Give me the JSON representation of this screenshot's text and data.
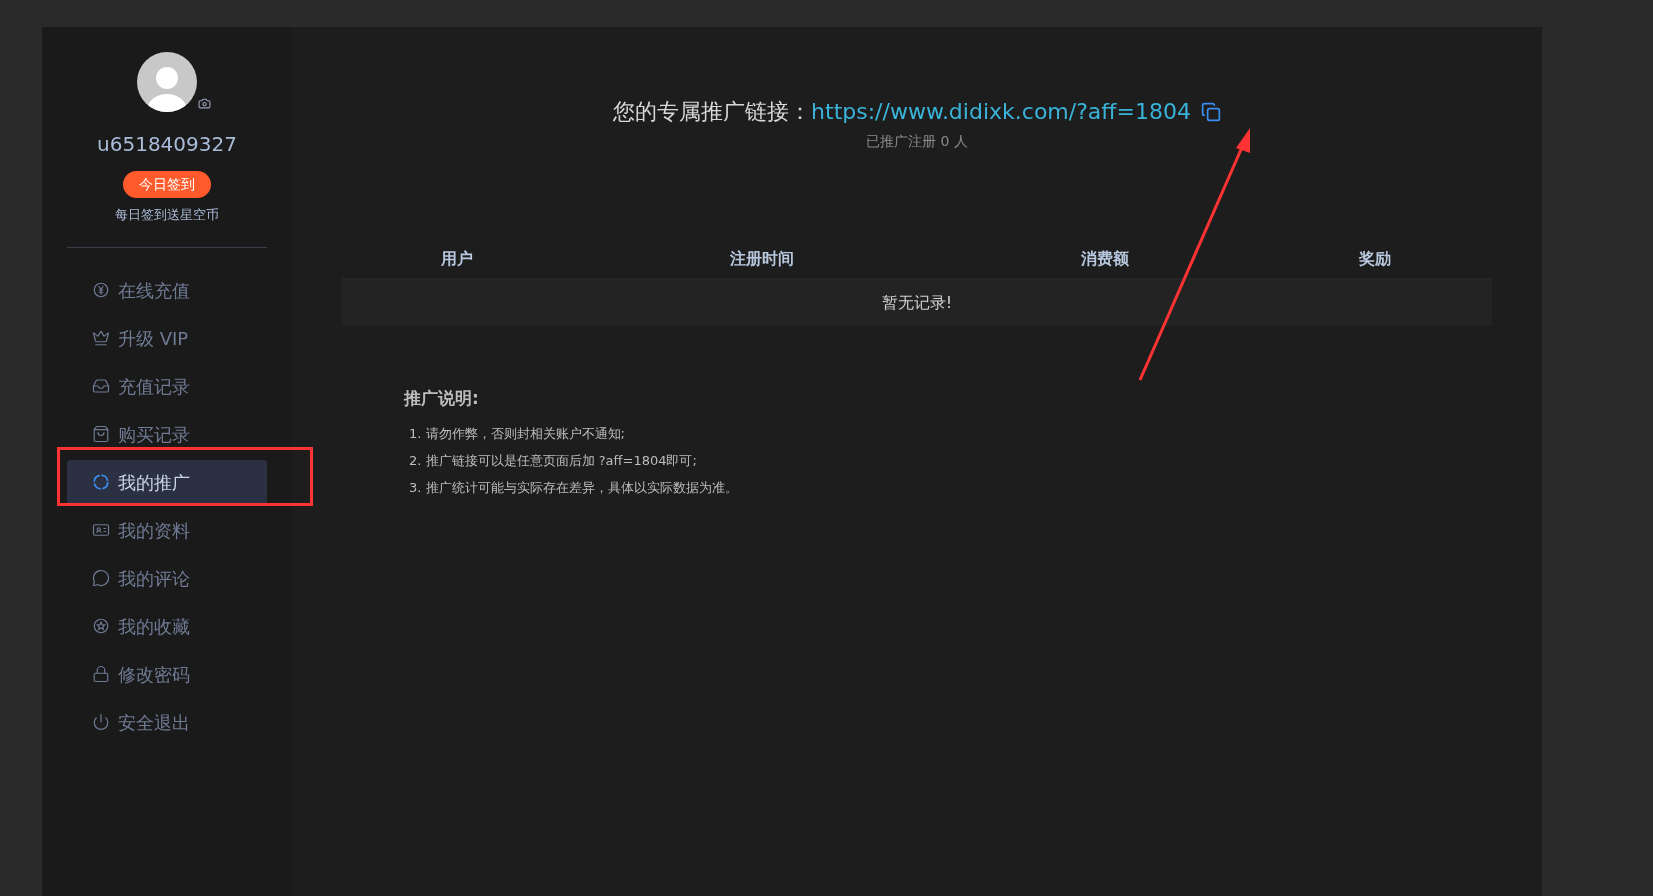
{
  "profile": {
    "username": "u6518409327",
    "checkin_button": "今日签到",
    "checkin_hint": "每日签到送星空币"
  },
  "sidebar": {
    "items": [
      {
        "kind": "yen",
        "label": "在线充值",
        "selected": false
      },
      {
        "kind": "crown",
        "label": "升级 VIP",
        "selected": false
      },
      {
        "kind": "inbox",
        "label": "充值记录",
        "selected": false
      },
      {
        "kind": "bag",
        "label": "购买记录",
        "selected": false
      },
      {
        "kind": "promo",
        "label": "我的推广",
        "selected": true
      },
      {
        "kind": "card",
        "label": "我的资料",
        "selected": false
      },
      {
        "kind": "chat",
        "label": "我的评论",
        "selected": false
      },
      {
        "kind": "star",
        "label": "我的收藏",
        "selected": false
      },
      {
        "kind": "lock",
        "label": "修改密码",
        "selected": false
      },
      {
        "kind": "power",
        "label": "安全退出",
        "selected": false
      }
    ]
  },
  "promo": {
    "label": "您的专属推广链接：",
    "link": "https://www.didixk.com/?aff=1804",
    "registered": "已推广注册 0 人"
  },
  "table": {
    "columns": [
      "用户",
      "注册时间",
      "消费额",
      "奖励"
    ],
    "empty_message": "暂无记录!"
  },
  "notes": {
    "title": "推广说明:",
    "items": [
      "1. 请勿作弊，否则封相关账户不通知;",
      "2. 推广链接可以是任意页面后加 ?aff=1804即可;",
      "3. 推广统计可能与实际存在差异，具体以实际数据为准。"
    ]
  }
}
